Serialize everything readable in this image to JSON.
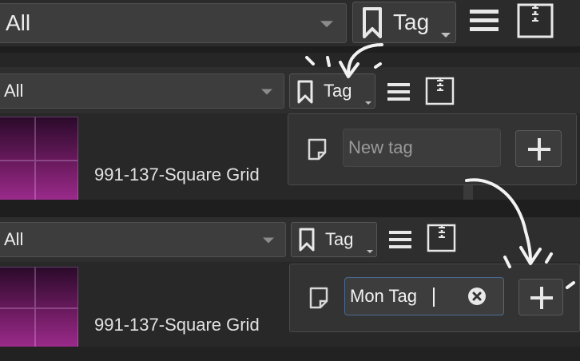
{
  "panels": [
    {
      "filter": "All",
      "tag_label": "Tag"
    },
    {
      "filter": "All",
      "tag_label": "Tag",
      "item_name": "991-137-Square Grid",
      "popup": {
        "placeholder": "New tag",
        "value": ""
      }
    },
    {
      "filter": "All",
      "tag_label": "Tag",
      "item_name": "991-137-Square Grid",
      "popup": {
        "placeholder": "New tag",
        "value": "Mon Tag"
      }
    }
  ],
  "colors": {
    "panel_bg": "#2f2f2f",
    "gradient_top": "#2a0a2a",
    "gradient_bottom": "#9a2a8a",
    "annotation": "#f2f2f2"
  },
  "icons": [
    "bookmark-icon",
    "list-icon",
    "zip-archive-icon",
    "note-icon",
    "plus-icon",
    "clear-icon",
    "arrow-annotation"
  ]
}
